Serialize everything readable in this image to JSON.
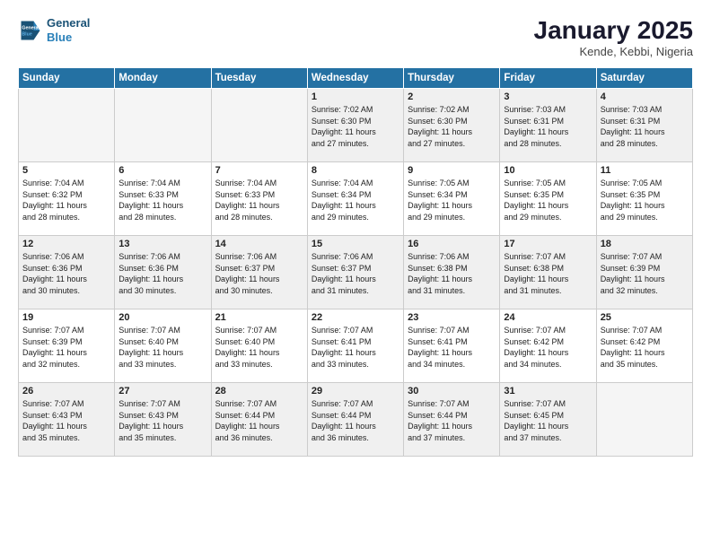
{
  "logo": {
    "line1": "General",
    "line2": "Blue"
  },
  "title": "January 2025",
  "subtitle": "Kende, Kebbi, Nigeria",
  "headers": [
    "Sunday",
    "Monday",
    "Tuesday",
    "Wednesday",
    "Thursday",
    "Friday",
    "Saturday"
  ],
  "weeks": [
    [
      {
        "day": "",
        "info": ""
      },
      {
        "day": "",
        "info": ""
      },
      {
        "day": "",
        "info": ""
      },
      {
        "day": "1",
        "info": "Sunrise: 7:02 AM\nSunset: 6:30 PM\nDaylight: 11 hours\nand 27 minutes."
      },
      {
        "day": "2",
        "info": "Sunrise: 7:02 AM\nSunset: 6:30 PM\nDaylight: 11 hours\nand 27 minutes."
      },
      {
        "day": "3",
        "info": "Sunrise: 7:03 AM\nSunset: 6:31 PM\nDaylight: 11 hours\nand 28 minutes."
      },
      {
        "day": "4",
        "info": "Sunrise: 7:03 AM\nSunset: 6:31 PM\nDaylight: 11 hours\nand 28 minutes."
      }
    ],
    [
      {
        "day": "5",
        "info": "Sunrise: 7:04 AM\nSunset: 6:32 PM\nDaylight: 11 hours\nand 28 minutes."
      },
      {
        "day": "6",
        "info": "Sunrise: 7:04 AM\nSunset: 6:33 PM\nDaylight: 11 hours\nand 28 minutes."
      },
      {
        "day": "7",
        "info": "Sunrise: 7:04 AM\nSunset: 6:33 PM\nDaylight: 11 hours\nand 28 minutes."
      },
      {
        "day": "8",
        "info": "Sunrise: 7:04 AM\nSunset: 6:34 PM\nDaylight: 11 hours\nand 29 minutes."
      },
      {
        "day": "9",
        "info": "Sunrise: 7:05 AM\nSunset: 6:34 PM\nDaylight: 11 hours\nand 29 minutes."
      },
      {
        "day": "10",
        "info": "Sunrise: 7:05 AM\nSunset: 6:35 PM\nDaylight: 11 hours\nand 29 minutes."
      },
      {
        "day": "11",
        "info": "Sunrise: 7:05 AM\nSunset: 6:35 PM\nDaylight: 11 hours\nand 29 minutes."
      }
    ],
    [
      {
        "day": "12",
        "info": "Sunrise: 7:06 AM\nSunset: 6:36 PM\nDaylight: 11 hours\nand 30 minutes."
      },
      {
        "day": "13",
        "info": "Sunrise: 7:06 AM\nSunset: 6:36 PM\nDaylight: 11 hours\nand 30 minutes."
      },
      {
        "day": "14",
        "info": "Sunrise: 7:06 AM\nSunset: 6:37 PM\nDaylight: 11 hours\nand 30 minutes."
      },
      {
        "day": "15",
        "info": "Sunrise: 7:06 AM\nSunset: 6:37 PM\nDaylight: 11 hours\nand 31 minutes."
      },
      {
        "day": "16",
        "info": "Sunrise: 7:06 AM\nSunset: 6:38 PM\nDaylight: 11 hours\nand 31 minutes."
      },
      {
        "day": "17",
        "info": "Sunrise: 7:07 AM\nSunset: 6:38 PM\nDaylight: 11 hours\nand 31 minutes."
      },
      {
        "day": "18",
        "info": "Sunrise: 7:07 AM\nSunset: 6:39 PM\nDaylight: 11 hours\nand 32 minutes."
      }
    ],
    [
      {
        "day": "19",
        "info": "Sunrise: 7:07 AM\nSunset: 6:39 PM\nDaylight: 11 hours\nand 32 minutes."
      },
      {
        "day": "20",
        "info": "Sunrise: 7:07 AM\nSunset: 6:40 PM\nDaylight: 11 hours\nand 33 minutes."
      },
      {
        "day": "21",
        "info": "Sunrise: 7:07 AM\nSunset: 6:40 PM\nDaylight: 11 hours\nand 33 minutes."
      },
      {
        "day": "22",
        "info": "Sunrise: 7:07 AM\nSunset: 6:41 PM\nDaylight: 11 hours\nand 33 minutes."
      },
      {
        "day": "23",
        "info": "Sunrise: 7:07 AM\nSunset: 6:41 PM\nDaylight: 11 hours\nand 34 minutes."
      },
      {
        "day": "24",
        "info": "Sunrise: 7:07 AM\nSunset: 6:42 PM\nDaylight: 11 hours\nand 34 minutes."
      },
      {
        "day": "25",
        "info": "Sunrise: 7:07 AM\nSunset: 6:42 PM\nDaylight: 11 hours\nand 35 minutes."
      }
    ],
    [
      {
        "day": "26",
        "info": "Sunrise: 7:07 AM\nSunset: 6:43 PM\nDaylight: 11 hours\nand 35 minutes."
      },
      {
        "day": "27",
        "info": "Sunrise: 7:07 AM\nSunset: 6:43 PM\nDaylight: 11 hours\nand 35 minutes."
      },
      {
        "day": "28",
        "info": "Sunrise: 7:07 AM\nSunset: 6:44 PM\nDaylight: 11 hours\nand 36 minutes."
      },
      {
        "day": "29",
        "info": "Sunrise: 7:07 AM\nSunset: 6:44 PM\nDaylight: 11 hours\nand 36 minutes."
      },
      {
        "day": "30",
        "info": "Sunrise: 7:07 AM\nSunset: 6:44 PM\nDaylight: 11 hours\nand 37 minutes."
      },
      {
        "day": "31",
        "info": "Sunrise: 7:07 AM\nSunset: 6:45 PM\nDaylight: 11 hours\nand 37 minutes."
      },
      {
        "day": "",
        "info": ""
      }
    ]
  ]
}
